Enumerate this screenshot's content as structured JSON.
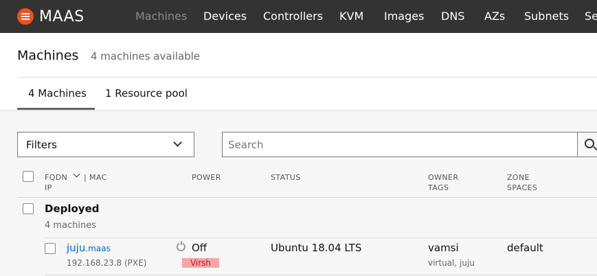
{
  "app": {
    "logo_text": "MAAS",
    "nav": [
      "Machines",
      "Devices",
      "Controllers",
      "KVM",
      "Images",
      "DNS",
      "AZs",
      "Subnets",
      "Se"
    ],
    "active_nav": "Machines"
  },
  "header": {
    "title": "Machines",
    "subtitle": "4 machines available",
    "tabs": [
      "4 Machines",
      "1 Resource pool"
    ],
    "active_tab": "4 Machines"
  },
  "controls": {
    "filters_label": "Filters",
    "search_placeholder": "Search",
    "search_value": ""
  },
  "table": {
    "columns": {
      "fqdn": "FQDN",
      "mac": "| MAC",
      "ip": "IP",
      "power": "POWER",
      "status": "STATUS",
      "owner": "OWNER",
      "tags": "TAGS",
      "zone": "ZONE",
      "spaces": "SPACES"
    },
    "group": {
      "title": "Deployed",
      "count": "4 machines"
    },
    "rows": [
      {
        "host": "juju",
        "domain": ".maas",
        "ip": "192.168.23.8 (PXE)",
        "power": "Off",
        "power_type": "Virsh",
        "status": "Ubuntu 18.04 LTS",
        "owner": "vamsi",
        "tags": "virtual, juju",
        "zone": "default"
      }
    ]
  },
  "colors": {
    "nav_bg": "#333333",
    "brand": "#e95420",
    "link": "#0066cc",
    "power_type_bg": "#f4a7a7",
    "power_type_text": "#c7162b"
  },
  "icons": [
    "maas-logo-icon",
    "chevron-down-icon",
    "search-icon",
    "power-icon"
  ]
}
